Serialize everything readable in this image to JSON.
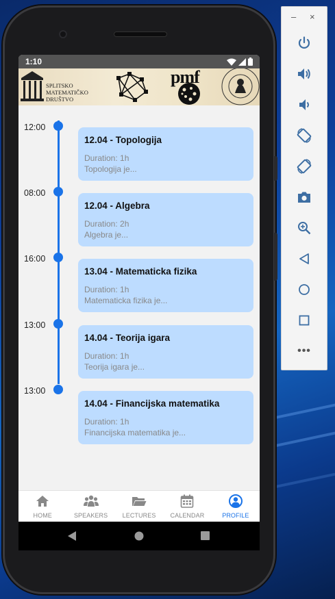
{
  "status_bar": {
    "time": "1:10"
  },
  "banner": {
    "society_name": "SPLITSKO\nMATEMATIČKO\nDRUŠTVO",
    "logo_text": "pmf"
  },
  "events": [
    {
      "time": "12:00",
      "title": "12.04 - Topologija",
      "duration": "Duration: 1h",
      "description": "Topologija je..."
    },
    {
      "time": "08:00",
      "title": "12.04 - Algebra",
      "duration": "Duration: 2h",
      "description": "Algebra je..."
    },
    {
      "time": "16:00",
      "title": "13.04 - Matematicka fizika",
      "duration": "Duration: 1h",
      "description": "Matematicka fizika je..."
    },
    {
      "time": "13:00",
      "title": "14.04 - Teorija igara",
      "duration": "Duration: 1h",
      "description": "Teorija igara je..."
    },
    {
      "time": "13:00",
      "title": "14.04 - Financijska matematika",
      "duration": "Duration: 1h",
      "description": "Financijska matematika je..."
    }
  ],
  "bottom_nav": [
    {
      "label": "HOME",
      "icon": "home-icon",
      "active": false
    },
    {
      "label": "SPEAKERS",
      "icon": "people-icon",
      "active": false
    },
    {
      "label": "LECTURES",
      "icon": "folder-icon",
      "active": false
    },
    {
      "label": "CALENDAR",
      "icon": "calendar-icon",
      "active": false
    },
    {
      "label": "PROFILE",
      "icon": "profile-icon",
      "active": true
    }
  ],
  "emulator_toolbar": {
    "minimize": "–",
    "close": "×",
    "more": "•••",
    "buttons": [
      "power-icon",
      "volume-up-icon",
      "volume-down-icon",
      "rotate-left-icon",
      "rotate-right-icon",
      "camera-icon",
      "zoom-icon",
      "back-icon",
      "home-circle-icon",
      "overview-icon",
      "more-icon"
    ]
  },
  "colors": {
    "accent": "#1a73e8",
    "card": "#bddcff",
    "screen_bg": "#f2f2f2",
    "status_bar": "#545454"
  }
}
